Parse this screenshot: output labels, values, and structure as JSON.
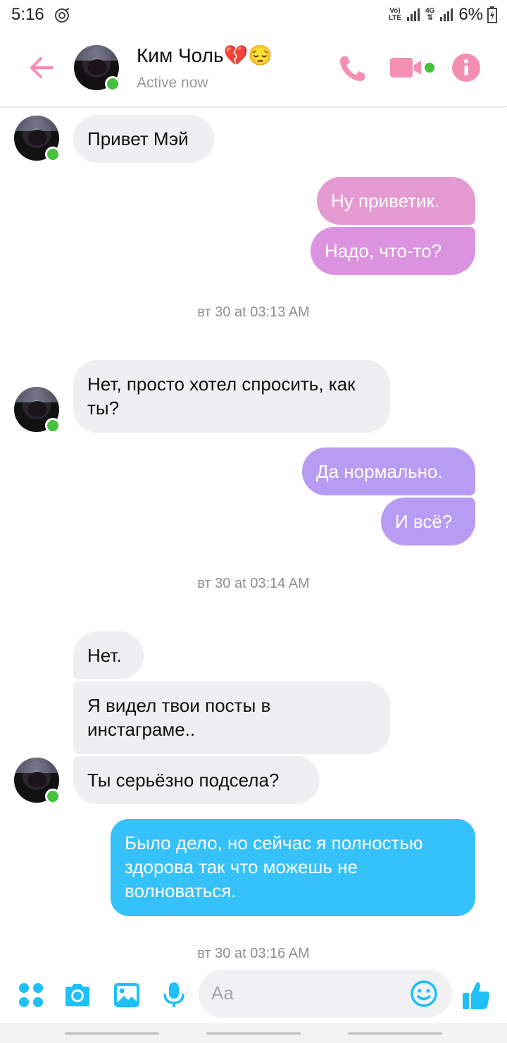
{
  "status_bar": {
    "time": "5:16",
    "lte_top": "Vo)",
    "lte_bottom": "LTE",
    "network": "4G",
    "battery": "6%"
  },
  "header": {
    "contact_name": "Ким Чоль💔😔",
    "contact_status": "Active now",
    "accent_color": "#f48fb1"
  },
  "messages": [
    {
      "type": "in",
      "text": "Привет Мэй"
    },
    {
      "type": "out",
      "text": "Ну приветик."
    },
    {
      "type": "out",
      "text": "Надо, что-то?"
    },
    {
      "type": "timestamp",
      "text": "вт 30 at 03:13 AM"
    },
    {
      "type": "in",
      "text": "Нет, просто хотел спросить, как ты?"
    },
    {
      "type": "out",
      "text": "Да нормально."
    },
    {
      "type": "out",
      "text": "И всё?"
    },
    {
      "type": "timestamp",
      "text": "вт 30 at 03:14 AM"
    },
    {
      "type": "in",
      "text": "Нет."
    },
    {
      "type": "in",
      "text": "Я видел твои посты в инстаграме.."
    },
    {
      "type": "in",
      "text": "Ты серьёзно подсела?"
    },
    {
      "type": "out",
      "text": "Было дело, но сейчас я полностью здорова так что можешь не волноваться."
    },
    {
      "type": "timestamp",
      "text": "вт 30 at 03:16 AM"
    }
  ],
  "bubble_colors": {
    "out_pink_1": "#e59ad1",
    "out_pink_2": "#dc93df",
    "out_purple": "#b89bf3",
    "out_blue": "#35c1f9",
    "in_gray": "#efeef0"
  },
  "composer": {
    "placeholder": "Aa",
    "icons": [
      "apps-icon",
      "camera-icon",
      "gallery-icon",
      "microphone-icon",
      "emoji-icon",
      "thumbs-up-icon"
    ],
    "accent_color": "#1ec0f7"
  }
}
